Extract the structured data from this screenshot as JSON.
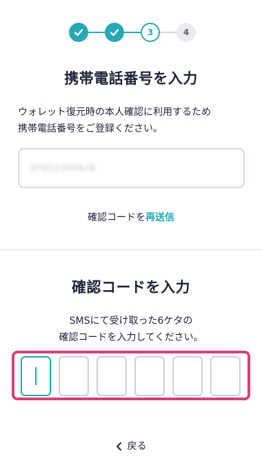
{
  "stepper": {
    "steps": [
      {
        "label": "",
        "state": "done"
      },
      {
        "label": "",
        "state": "done"
      },
      {
        "label": "3",
        "state": "current"
      },
      {
        "label": "4",
        "state": "todo"
      }
    ]
  },
  "phone_section": {
    "title": "携帯電話番号を入力",
    "description_line1": "ウォレット復元時の本人確認に利用するため",
    "description_line2": "携帯電話番号をご登録ください。",
    "phone_value": "07012345678"
  },
  "resend": {
    "label": "確認コードを",
    "link": "再送信"
  },
  "code_section": {
    "title": "確認コードを入力",
    "description_line1": "SMSにて受け取った6ケタの",
    "description_line2": "確認コードを入力してください。",
    "code_digits": [
      "",
      "",
      "",
      "",
      "",
      ""
    ]
  },
  "back": {
    "label": "戻る"
  },
  "colors": {
    "accent": "#26a9b4",
    "highlight": "#d54178",
    "text": "#1f2235"
  }
}
